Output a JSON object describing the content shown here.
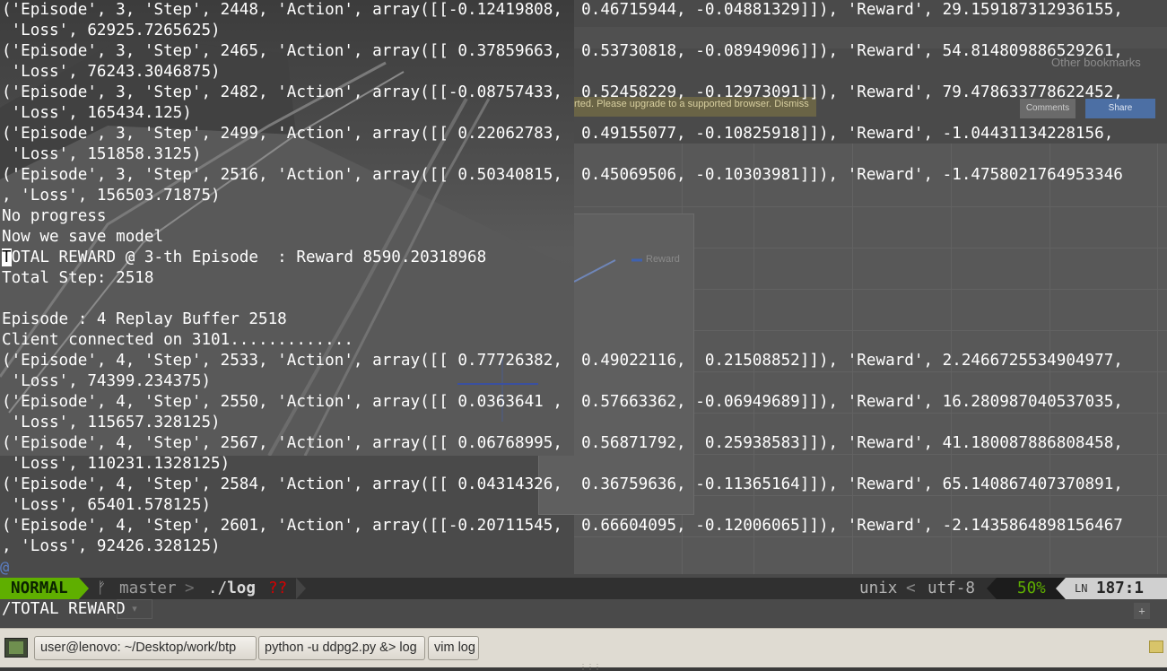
{
  "terminal": {
    "lines": [
      "('Episode', 3, 'Step', 2448, 'Action', array([[-0.12419808,  0.46715944, -0.04881329]]), 'Reward', 29.159187312936155,",
      " 'Loss', 62925.7265625)",
      "('Episode', 3, 'Step', 2465, 'Action', array([[ 0.37859663,  0.53730818, -0.08949096]]), 'Reward', 54.814809886529261,",
      " 'Loss', 76243.3046875)",
      "('Episode', 3, 'Step', 2482, 'Action', array([[-0.08757433,  0.52458229, -0.12973091]]), 'Reward', 79.478633778622452,",
      " 'Loss', 165434.125)",
      "('Episode', 3, 'Step', 2499, 'Action', array([[ 0.22062783,  0.49155077, -0.10825918]]), 'Reward', -1.04431134228156,",
      " 'Loss', 151858.3125)",
      "('Episode', 3, 'Step', 2516, 'Action', array([[ 0.50340815,  0.45069506, -0.10303981]]), 'Reward', -1.4758021764953346",
      ", 'Loss', 156503.71875)",
      "No progress",
      "Now we save model",
      "OTAL REWARD @ 3-th Episode  : Reward 8590.20318968",
      "Total Step: 2518",
      "",
      "Episode : 4 Replay Buffer 2518",
      "Client connected on 3101.............",
      "('Episode', 4, 'Step', 2533, 'Action', array([[ 0.77726382,  0.49022116,  0.21508852]]), 'Reward', 2.2466725534904977,",
      " 'Loss', 74399.234375)",
      "('Episode', 4, 'Step', 2550, 'Action', array([[ 0.0363641 ,  0.57663362, -0.06949689]]), 'Reward', 16.280987040537035,",
      " 'Loss', 115657.328125)",
      "('Episode', 4, 'Step', 2567, 'Action', array([[ 0.06768995,  0.56871792,  0.25938583]]), 'Reward', 41.180087886808458,",
      " 'Loss', 110231.1328125)",
      "('Episode', 4, 'Step', 2584, 'Action', array([[ 0.04314326,  0.36759636, -0.11365164]]), 'Reward', 65.140867407370891,",
      " 'Loss', 65401.578125)",
      "('Episode', 4, 'Step', 2601, 'Action', array([[-0.20711545,  0.66604095, -0.12006065]]), 'Reward', -2.1435864898156467",
      ", 'Loss', 92426.328125)"
    ],
    "cursor_char": "T",
    "tilde": "@"
  },
  "statusline": {
    "mode": "NORMAL",
    "branch_icon": "ᚠ",
    "branch": "master",
    "sep": ">",
    "file_dir": "./",
    "file_name": "log",
    "modified": "??",
    "fileformat": "unix",
    "sep_left": "<",
    "encoding": "utf-8",
    "percent": "50%",
    "ln_icon": "LN",
    "line": "187",
    "col_sep": ":",
    "col": "1"
  },
  "cmdline": {
    "text": "/TOTAL REWARD"
  },
  "taskbar": {
    "items": [
      {
        "label": "user@lenovo: ~/Desktop/work/btp"
      },
      {
        "label": "python -u ddpg2.py &> log"
      },
      {
        "label": "vim log"
      }
    ]
  },
  "background": {
    "browser_warning": "rted. Please upgrade to a supported browser.  Dismiss",
    "other_bookmarks": "Other bookmarks",
    "comments_label": "Comments",
    "share_label": "Share",
    "chart_legend": "Reward"
  },
  "colors": {
    "mode_bg": "#5faf00",
    "modified_flag": "#d70000",
    "percent": "#5faf00",
    "terminal_text": "#ffffff"
  },
  "icons": {
    "show_desktop": "show-desktop-icon",
    "branch": "git-branch-icon",
    "line_number": "line-number-icon",
    "tray": "notification-tray-icon"
  }
}
